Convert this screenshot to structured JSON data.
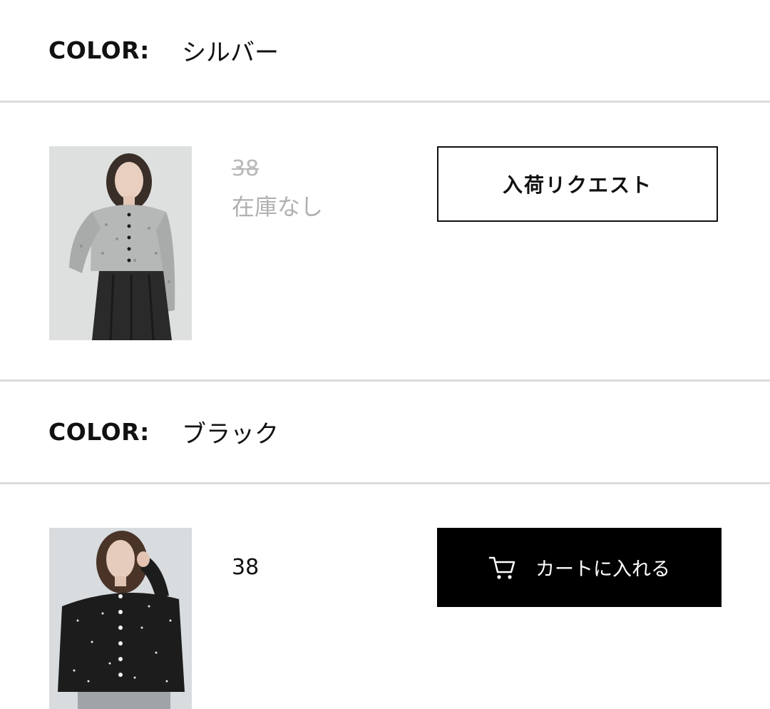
{
  "variants": [
    {
      "color_label": "COLOR:",
      "color_value": "シルバー",
      "image_alt": "silver cardigan model photo",
      "size": "38",
      "stock_status": "在庫なし",
      "button_label": "入荷リクエスト",
      "in_stock": false
    },
    {
      "color_label": "COLOR:",
      "color_value": "ブラック",
      "image_alt": "black cardigan model photo",
      "size": "38",
      "button_label": "カートに入れる",
      "button_icon": "cart-icon",
      "in_stock": true
    }
  ],
  "colors": {
    "divider": "#dcdcdc",
    "disabled_text": "#b0b0b0",
    "cart_button_bg": "#000000",
    "cart_button_text": "#ffffff"
  }
}
